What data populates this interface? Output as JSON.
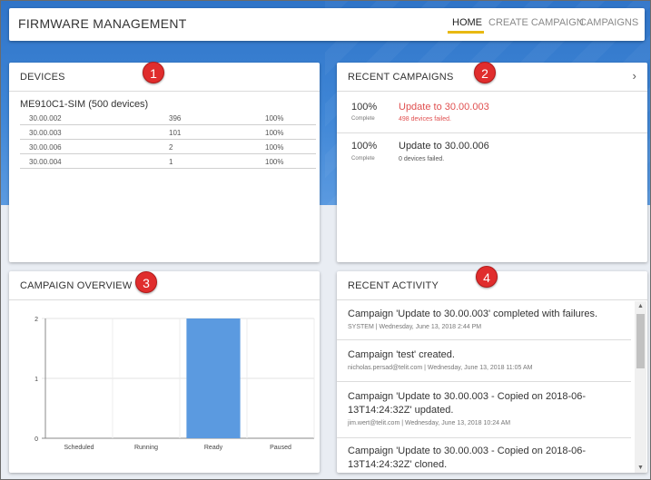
{
  "app": {
    "title": "FIRMWARE MANAGEMENT"
  },
  "nav": {
    "items": [
      "HOME",
      "CREATE CAMPAIGN",
      "CAMPAIGNS"
    ],
    "active": "HOME",
    "accent": "#e8b912"
  },
  "badges": [
    "1",
    "2",
    "3",
    "4"
  ],
  "devices": {
    "title": "DEVICES",
    "group": "ME910C1-SIM (500 devices)",
    "rows": [
      {
        "version": "30.00.002",
        "count": "396",
        "pct": "100%"
      },
      {
        "version": "30.00.003",
        "count": "101",
        "pct": "100%"
      },
      {
        "version": "30.00.006",
        "count": "2",
        "pct": "100%"
      },
      {
        "version": "30.00.004",
        "count": "1",
        "pct": "100%"
      }
    ]
  },
  "recent_campaigns": {
    "title": "RECENT CAMPAIGNS",
    "chevron": "›",
    "items": [
      {
        "pct": "100%",
        "status": "Complete",
        "name": "Update to 30.00.003",
        "sub": "498 devices failed.",
        "color": "#e05050"
      },
      {
        "pct": "100%",
        "status": "Complete",
        "name": "Update to 30.00.006",
        "sub": "0 devices failed.",
        "color": "#333333"
      }
    ]
  },
  "campaign_overview": {
    "title": "CAMPAIGN OVERVIEW"
  },
  "chart_data": {
    "type": "bar",
    "categories": [
      "Scheduled",
      "Running",
      "Ready",
      "Paused"
    ],
    "values": [
      0,
      0,
      2,
      0
    ],
    "yticks": [
      "0",
      "1",
      "2"
    ],
    "ylim": [
      0,
      2
    ],
    "bar_color": "#5b9ae0",
    "grid": true
  },
  "recent_activity": {
    "title": "RECENT ACTIVITY",
    "items": [
      {
        "text": "Campaign 'Update to 30.00.003' completed with failures.",
        "meta": "SYSTEM | Wednesday, June 13, 2018 2:44 PM"
      },
      {
        "text": "Campaign 'test' created.",
        "meta": "nicholas.persad@telit.com | Wednesday, June 13, 2018 11:05 AM"
      },
      {
        "text": "Campaign 'Update to 30.00.003 - Copied on 2018-06-13T14:24:32Z' updated.",
        "meta": "jim.wert@telit.com | Wednesday, June 13, 2018 10:24 AM"
      },
      {
        "text": "Campaign 'Update to 30.00.003 - Copied on 2018-06-13T14:24:32Z' cloned.",
        "meta": ""
      }
    ],
    "scroll_up": "▲",
    "scroll_down": "▼"
  }
}
